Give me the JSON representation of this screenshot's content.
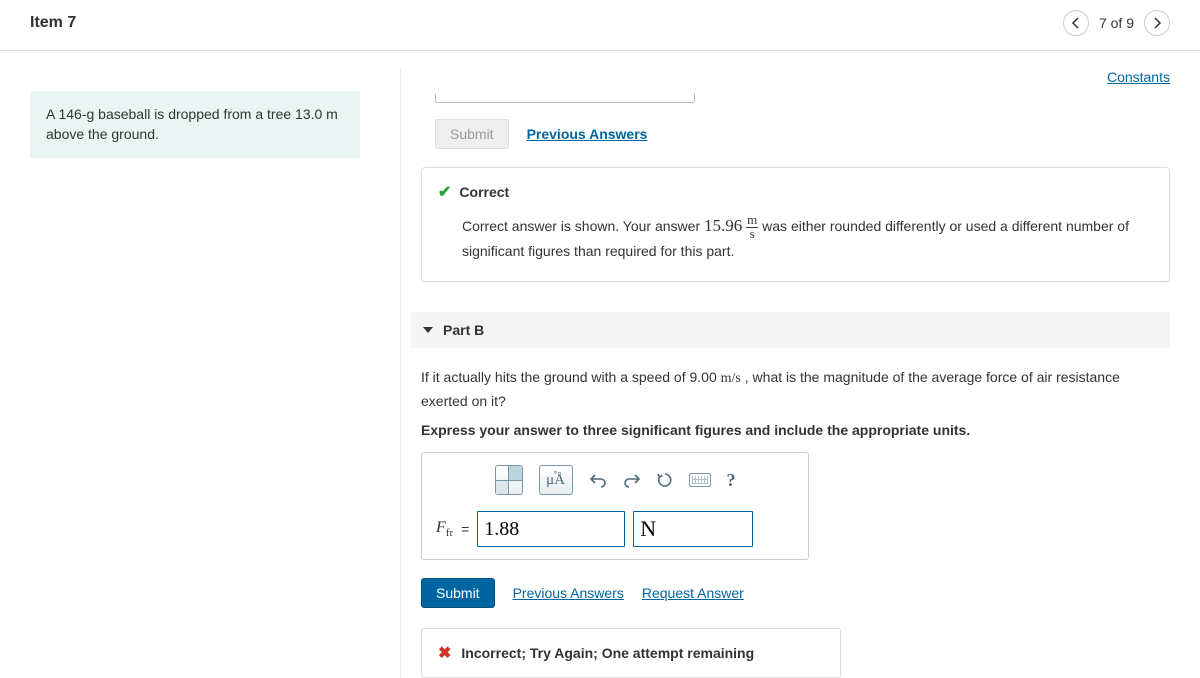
{
  "header": {
    "title": "Item 7",
    "page_indicator": "7 of 9"
  },
  "constants_label": "Constants",
  "problem_text": "A 146-g baseball is dropped from a tree 13.0 m above the ground.",
  "partA": {
    "submit_label": "Submit",
    "prev_answers_label": "Previous Answers",
    "correct_title": "Correct",
    "feedback_pre": "Correct answer is shown. Your answer ",
    "answer_value": "15.96",
    "unit_top": "m",
    "unit_bot": "s",
    "feedback_post": " was either rounded differently or used a different number of significant figures than required for this part."
  },
  "partB": {
    "title": "Part B",
    "question_pre": "If it actually hits the ground with a speed of 9.00 ",
    "speed_unit": "m/s",
    "question_post": " , what is the magnitude of the average force of air resistance exerted on it?",
    "instruction": "Express your answer to three significant figures and include the appropriate units.",
    "mu_label": "μÅ",
    "help_label": "?",
    "var_label": "F",
    "var_sub": "fr",
    "eq": "=",
    "value_input": "1.88",
    "unit_input": "N",
    "submit_label": "Submit",
    "prev_answers_label": "Previous Answers",
    "request_answer_label": "Request Answer",
    "incorrect_msg": "Incorrect; Try Again; One attempt remaining"
  }
}
